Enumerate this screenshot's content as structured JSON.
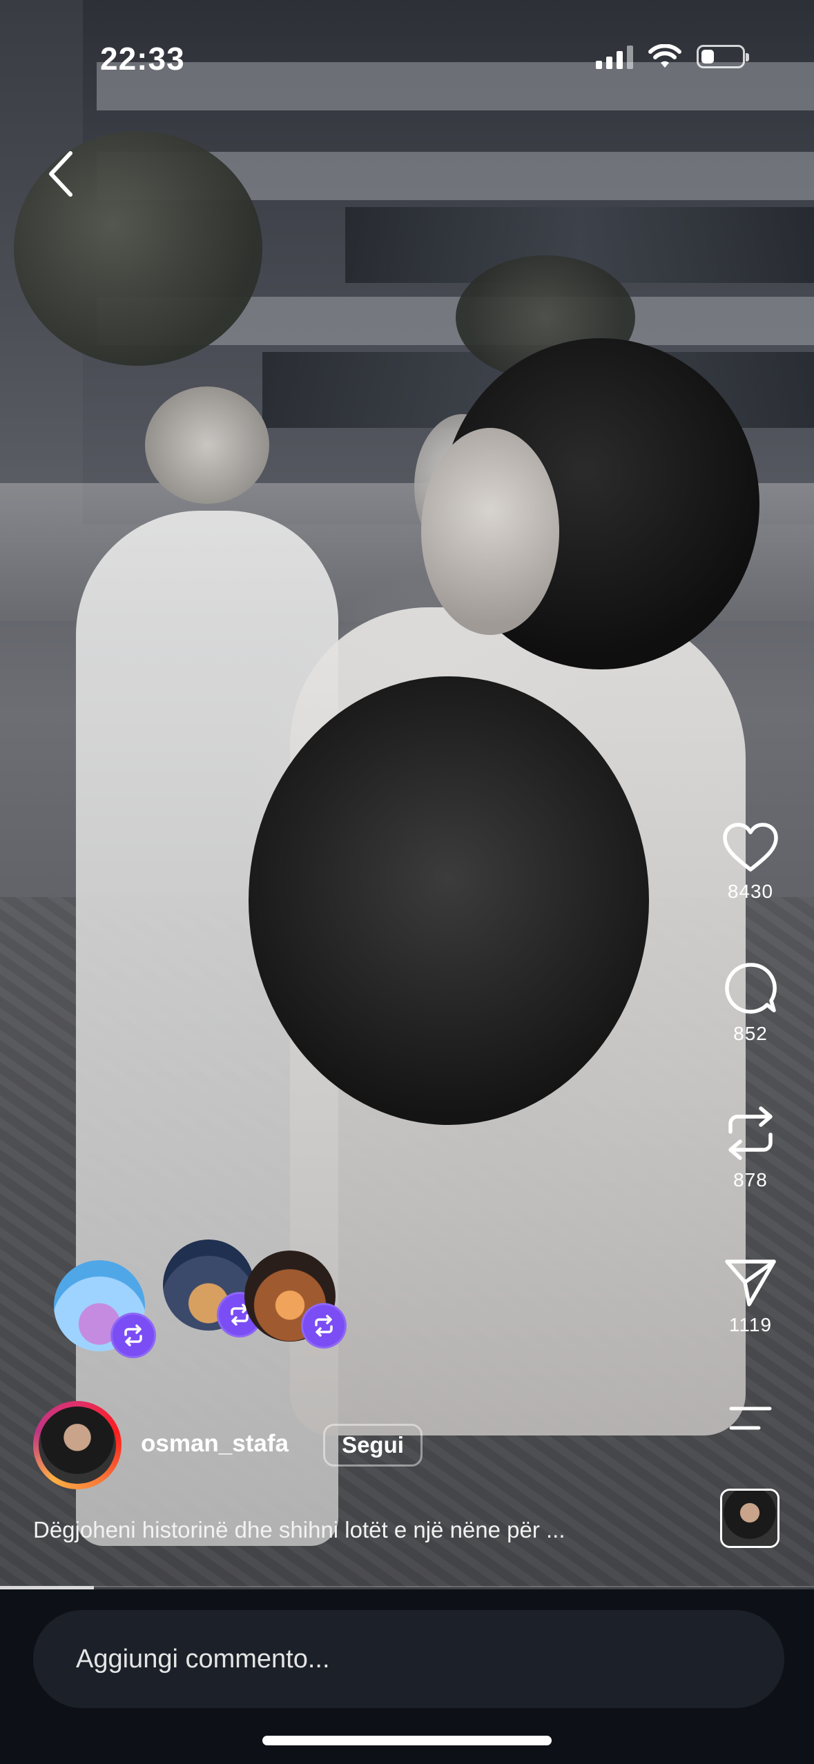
{
  "status_bar": {
    "time": "22:33"
  },
  "actions": {
    "likes": "8430",
    "comments": "852",
    "reposts": "878",
    "shares": "1119"
  },
  "author": {
    "username": "osman_stafa",
    "follow_label": "Segui"
  },
  "caption": "Dëgjoheni historinë dhe shihni lotët e një nëne për ...",
  "comment_input": {
    "placeholder": "Aggiungi commento..."
  },
  "video_progress": 0.115,
  "colors": {
    "repost_badge": "#7b4df5",
    "background": "#0d1117",
    "comment_box": "#1c2129"
  }
}
